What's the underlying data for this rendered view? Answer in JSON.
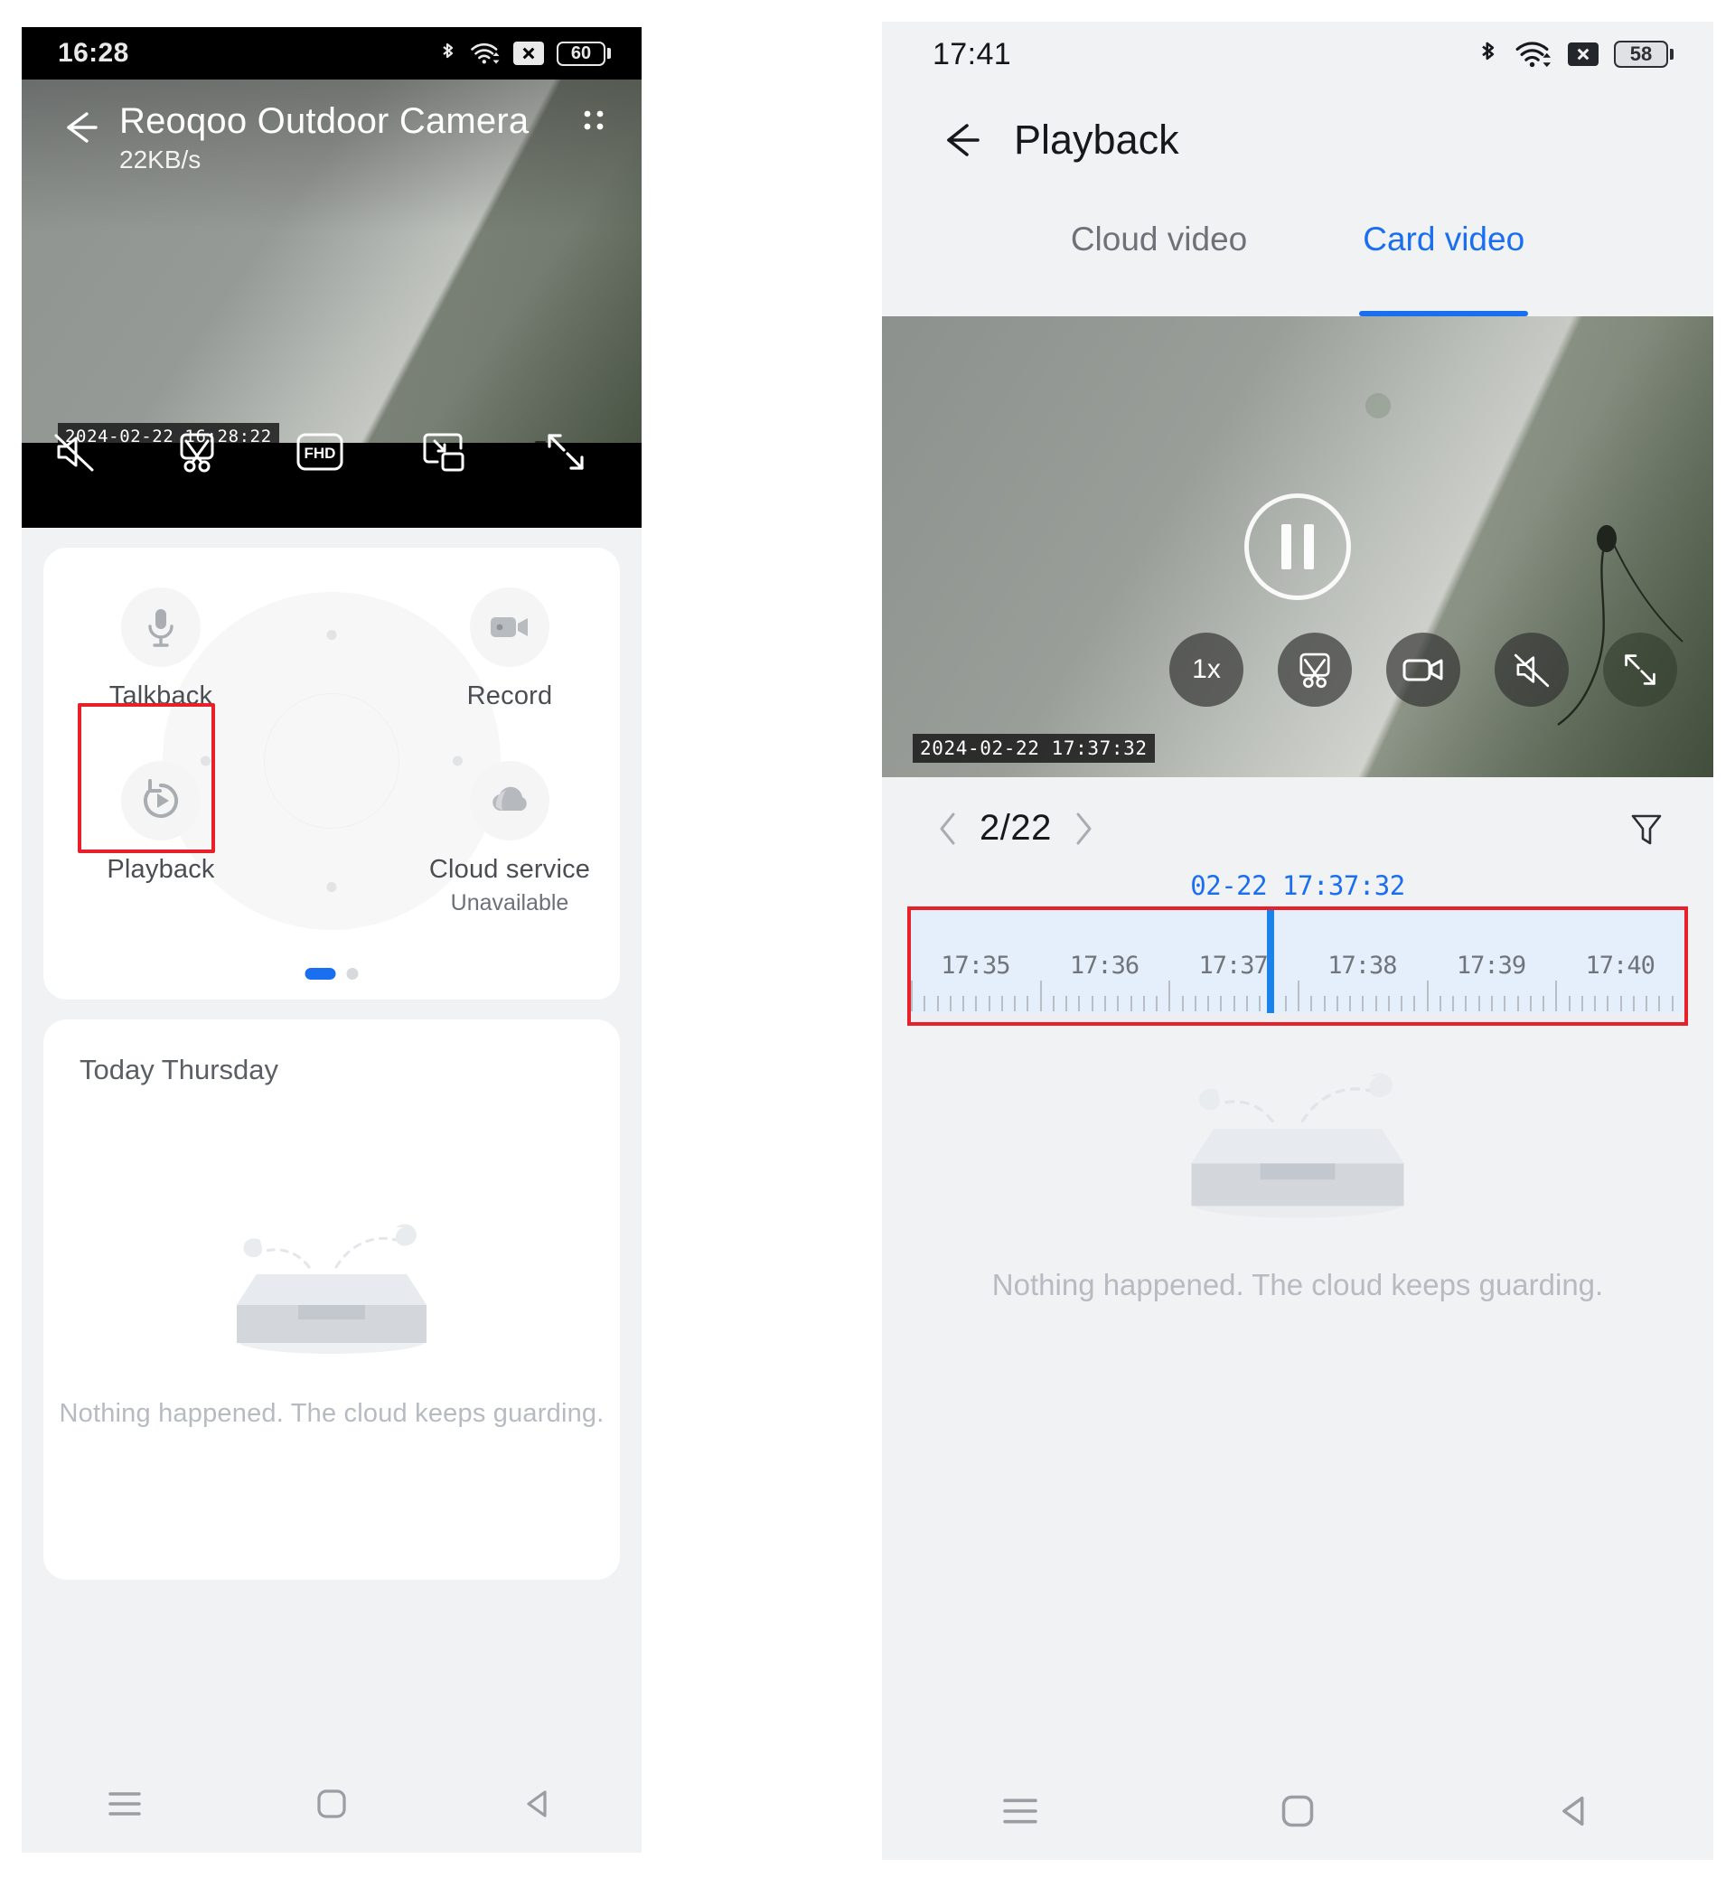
{
  "left_phone": {
    "status_bar": {
      "time": "16:28",
      "battery": "60",
      "icons": [
        "bluetooth-icon",
        "wifi-icon",
        "sim-no-service-icon",
        "battery-icon"
      ]
    },
    "video": {
      "title": "Reoqoo Outdoor Camera",
      "bitrate": "22KB/s",
      "timestamp": "2024-02-22  16:28:22",
      "back_icon": "back-arrow-icon",
      "more_icon": "more-options-icon",
      "controls": [
        {
          "name": "mute-toggle",
          "icon": "speaker-mute-icon",
          "label": ""
        },
        {
          "name": "clip-button",
          "icon": "scissors-clip-icon",
          "label": ""
        },
        {
          "name": "quality-button",
          "icon": "quality-icon",
          "label": "FHD"
        },
        {
          "name": "pip-button",
          "icon": "picture-in-picture-icon",
          "label": ""
        },
        {
          "name": "fullscreen-button",
          "icon": "fullscreen-icon",
          "label": ""
        }
      ]
    },
    "control_pad": {
      "quadrants": [
        {
          "name": "talkback",
          "label": "Talkback",
          "sub": "",
          "icon": "microphone-icon"
        },
        {
          "name": "record",
          "label": "Record",
          "sub": "",
          "icon": "camcorder-icon"
        },
        {
          "name": "playback",
          "label": "Playback",
          "sub": "",
          "icon": "playback-icon",
          "highlighted": true
        },
        {
          "name": "cloud-service",
          "label": "Cloud service",
          "sub": "Unavailable",
          "icon": "cloud-icon"
        }
      ],
      "page_dots": 2,
      "active_dot": 0
    },
    "events": {
      "title": "Today Thursday",
      "empty_text": "Nothing happened. The cloud keeps guarding."
    },
    "nav_bar": [
      "menu-icon",
      "home-icon",
      "back-icon"
    ]
  },
  "right_phone": {
    "status_bar": {
      "time": "17:41",
      "battery": "58",
      "icons": [
        "bluetooth-icon",
        "wifi-icon",
        "sim-no-service-icon",
        "battery-icon"
      ]
    },
    "header": {
      "title": "Playback",
      "back_icon": "back-arrow-icon"
    },
    "tabs": [
      {
        "name": "tab-cloud-video",
        "label": "Cloud video",
        "active": false
      },
      {
        "name": "tab-card-video",
        "label": "Card video",
        "active": true
      }
    ],
    "video": {
      "timestamp": "2024-02-22  17:37:32",
      "state_icon": "pause-icon",
      "controls": [
        {
          "name": "speed-button",
          "icon": "speed-icon",
          "label": "1x"
        },
        {
          "name": "clip-button",
          "icon": "scissors-clip-icon",
          "label": ""
        },
        {
          "name": "record-button",
          "icon": "camcorder-icon",
          "label": ""
        },
        {
          "name": "mute-toggle",
          "icon": "speaker-mute-icon",
          "label": ""
        },
        {
          "name": "fullscreen-button",
          "icon": "fullscreen-icon",
          "label": ""
        }
      ]
    },
    "pager": {
      "prev_icon": "chevron-left-icon",
      "next_icon": "chevron-right-icon",
      "value": "2/22",
      "filter_icon": "filter-funnel-icon"
    },
    "timeline": {
      "current_time": "02-22 17:37:32",
      "tick_labels": [
        "17:35",
        "17:36",
        "17:37",
        "17:38",
        "17:39",
        "17:40"
      ],
      "playhead_percent": 46,
      "highlight_color": "#e8202a",
      "accent_color": "#1a6ef0"
    },
    "empty": {
      "text": "Nothing happened. The cloud keeps guarding."
    },
    "nav_bar": [
      "menu-icon",
      "home-icon",
      "back-icon"
    ]
  },
  "colors": {
    "accent": "#1a6ef0",
    "highlight": "#e8202a",
    "page_bg": "#f1f2f4",
    "card_bg": "#ffffff",
    "muted_text": "#b7bbc1"
  }
}
